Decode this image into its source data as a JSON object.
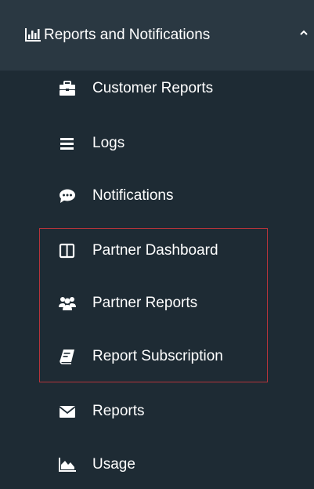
{
  "section": {
    "label": "Reports and Notifications",
    "icon": "bar-chart-icon",
    "expanded": true
  },
  "items": [
    {
      "label": "Customer Reports",
      "icon": "briefcase-icon"
    },
    {
      "label": "Logs",
      "icon": "bars-icon"
    },
    {
      "label": "Notifications",
      "icon": "comment-dots-icon"
    },
    {
      "label": "Partner Dashboard",
      "icon": "columns-icon"
    },
    {
      "label": "Partner Reports",
      "icon": "users-icon"
    },
    {
      "label": "Report Subscription",
      "icon": "book-icon"
    },
    {
      "label": "Reports",
      "icon": "envelope-icon"
    },
    {
      "label": "Usage",
      "icon": "area-chart-icon"
    }
  ],
  "colors": {
    "sidebar_bg": "#1e2b34",
    "header_bg": "#2a3842",
    "text": "#ffffff",
    "highlight_border": "#b5343a"
  }
}
